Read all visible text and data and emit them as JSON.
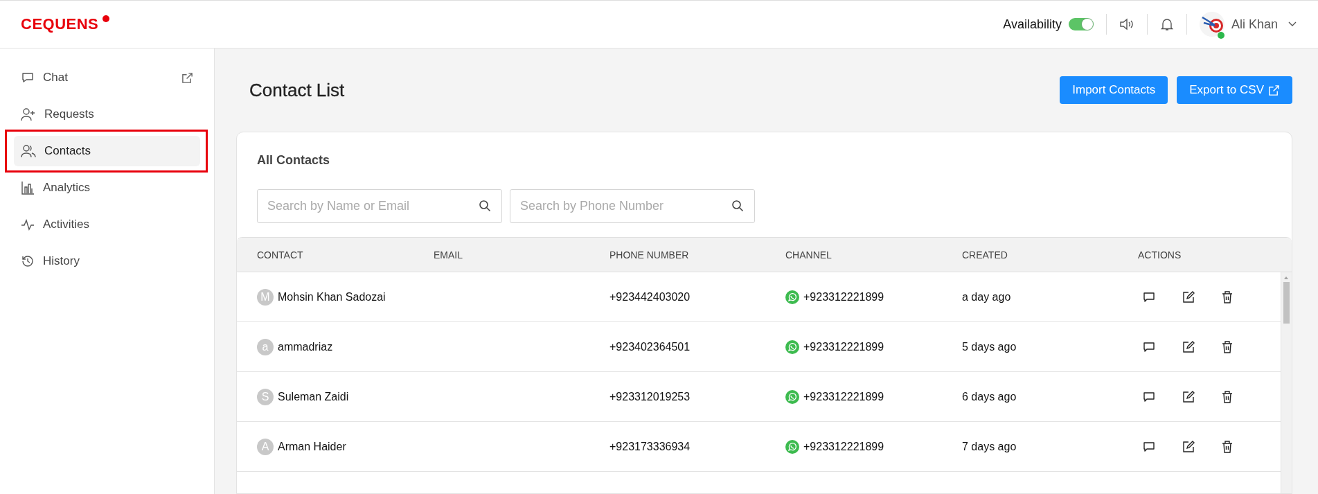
{
  "logo": {
    "text": "CEQUENS"
  },
  "header": {
    "availability": {
      "label": "Availability",
      "on": true
    },
    "user": {
      "name": "Ali Khan",
      "online": true
    }
  },
  "sidebar": {
    "items": [
      {
        "label": "Chat",
        "selected": false,
        "external": true,
        "outlined": false
      },
      {
        "label": "Requests",
        "selected": false,
        "external": false,
        "outlined": false
      },
      {
        "label": "Contacts",
        "selected": true,
        "external": false,
        "outlined": true
      },
      {
        "label": "Analytics",
        "selected": false,
        "external": false,
        "outlined": false
      },
      {
        "label": "Activities",
        "selected": false,
        "external": false,
        "outlined": false
      },
      {
        "label": "History",
        "selected": false,
        "external": false,
        "outlined": false
      }
    ]
  },
  "page": {
    "title": "Contact List",
    "buttons": [
      {
        "label": "Import Contacts",
        "external": false
      },
      {
        "label": "Export to CSV",
        "external": true
      }
    ]
  },
  "card": {
    "title": "All Contacts",
    "search_fields": [
      {
        "placeholder": "Search by Name or Email"
      },
      {
        "placeholder": "Search by Phone Number"
      }
    ],
    "table": {
      "columns": [
        "CONTACT",
        "EMAIL",
        "PHONE NUMBER",
        "CHANNEL",
        "CREATED",
        "ACTIONS"
      ],
      "rows": [
        {
          "initial": "M",
          "contact": "Mohsin Khan Sadozai",
          "phone": "+923442403020",
          "channel": {
            "kind": "whatsapp",
            "number": "+923312221899"
          },
          "created": "a day ago"
        },
        {
          "initial": "a",
          "contact": "ammadriaz",
          "phone": "+923402364501",
          "channel": {
            "kind": "whatsapp",
            "number": "+923312221899"
          },
          "created": "5 days ago"
        },
        {
          "initial": "S",
          "contact": "Suleman Zaidi",
          "phone": "+923312019253",
          "channel": {
            "kind": "whatsapp",
            "number": "+923312221899"
          },
          "created": "6 days ago"
        },
        {
          "initial": "A",
          "contact": "Arman Haider",
          "phone": "+923173336934",
          "channel": {
            "kind": "whatsapp",
            "number": "+923312221899"
          },
          "created": "7 days ago"
        }
      ]
    }
  }
}
